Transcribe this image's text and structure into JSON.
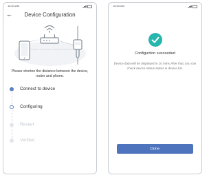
{
  "left_screen": {
    "status": {
      "time": "16:53 AM"
    },
    "title": "Device Configuration",
    "instruction": "Please shorten the distance between the device, router and phone.",
    "steps": [
      {
        "label": "Connect to device",
        "state": "done"
      },
      {
        "label": "Configuring",
        "state": "active"
      },
      {
        "label": "Restart",
        "state": "pending"
      },
      {
        "label": "Verified",
        "state": "pending"
      }
    ]
  },
  "right_screen": {
    "status": {
      "time": "16:53 AM"
    },
    "success_title": "Configurtion succeeded",
    "success_message": "Device data will be displayed in 10 mins.After that, you can check device status status in device list.",
    "done_label": "Done"
  },
  "colors": {
    "accent": "#5b7fc4",
    "button": "#4e74bd",
    "success": "#26b6ae",
    "pending": "#c3c7cd"
  },
  "icons": [
    "back-arrow-icon",
    "router-icon",
    "phone-icon",
    "sensor-device-icon",
    "checkmark-icon",
    "signal-icon",
    "battery-icon"
  ]
}
